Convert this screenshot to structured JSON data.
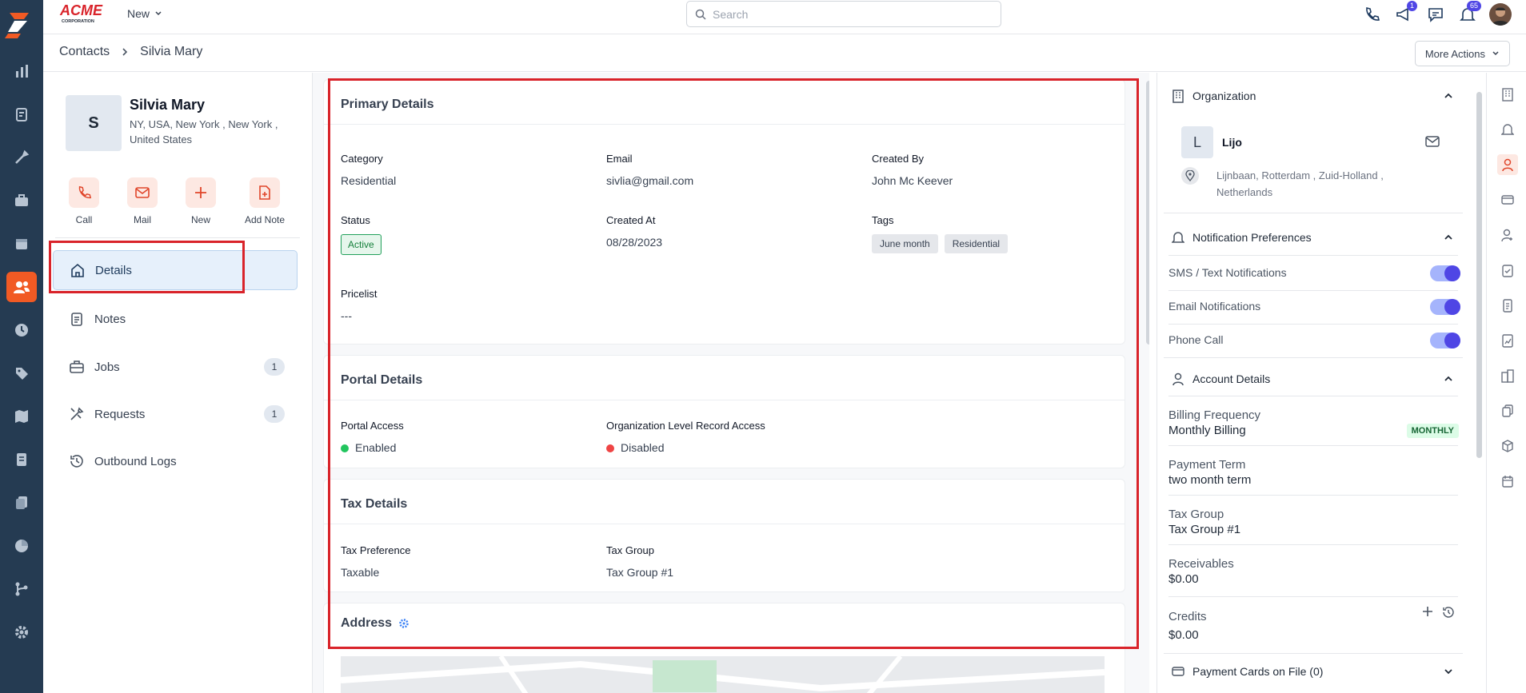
{
  "app": {
    "brand": "ACME CORPORATION"
  },
  "topbar": {
    "new_label": "New",
    "search_placeholder": "Search",
    "chat_badge": "1",
    "notif_badge": "65"
  },
  "breadcrumb": {
    "root": "Contacts",
    "current": "Silvia Mary"
  },
  "actions": {
    "more_actions": "More Actions"
  },
  "contact": {
    "initial": "S",
    "name": "Silvia Mary",
    "address": "NY, USA, New York , New York , United States"
  },
  "quick_actions": [
    {
      "label": "Call"
    },
    {
      "label": "Mail"
    },
    {
      "label": "New"
    },
    {
      "label": "Add Note"
    }
  ],
  "nav": [
    {
      "label": "Details"
    },
    {
      "label": "Notes"
    },
    {
      "label": "Jobs",
      "count": "1"
    },
    {
      "label": "Requests",
      "count": "1"
    },
    {
      "label": "Outbound Logs"
    }
  ],
  "primary": {
    "title": "Primary Details",
    "category_label": "Category",
    "category": "Residential",
    "email_label": "Email",
    "email": "sivlia@gmail.com",
    "created_by_label": "Created By",
    "created_by": "John Mc Keever",
    "status_label": "Status",
    "status": "Active",
    "created_at_label": "Created At",
    "created_at": "08/28/2023",
    "tags_label": "Tags",
    "tags": [
      "June month",
      "Residential"
    ],
    "pricelist_label": "Pricelist",
    "pricelist": "---"
  },
  "portal": {
    "title": "Portal Details",
    "access_label": "Portal Access",
    "access": "Enabled",
    "org_label": "Organization Level Record Access",
    "org": "Disabled"
  },
  "tax": {
    "title": "Tax Details",
    "pref_label": "Tax Preference",
    "pref": "Taxable",
    "group_label": "Tax Group",
    "group": "Tax Group #1"
  },
  "address": {
    "title": "Address"
  },
  "organization": {
    "title": "Organization",
    "initial": "L",
    "name": "Lijo",
    "address": "Lijnbaan, Rotterdam , Zuid-Holland , Netherlands"
  },
  "notifications": {
    "title": "Notification Preferences",
    "items": [
      {
        "label": "SMS / Text Notifications"
      },
      {
        "label": "Email Notifications"
      },
      {
        "label": "Phone Call"
      }
    ]
  },
  "account": {
    "title": "Account Details",
    "billing_label": "Billing Frequency",
    "billing": "Monthly Billing",
    "billing_badge": "MONTHLY",
    "term_label": "Payment Term",
    "term": "two month term",
    "taxgroup_label": "Tax Group",
    "taxgroup": "Tax Group #1",
    "receivables_label": "Receivables",
    "receivables": "$0.00",
    "credits_label": "Credits",
    "credits": "$0.00"
  },
  "payment_cards": {
    "title": "Payment Cards on File (0)"
  },
  "colors": {
    "accent": "#f15a24",
    "sidebar_bg": "#253b52",
    "toggle": "#4f46e5",
    "highlight": "#d9232a"
  }
}
